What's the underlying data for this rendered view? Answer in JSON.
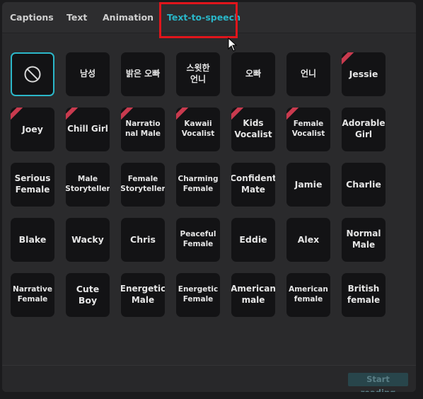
{
  "tabs": [
    {
      "label": "Captions"
    },
    {
      "label": "Text"
    },
    {
      "label": "Animation"
    },
    {
      "label": "Text-to-speech"
    }
  ],
  "voices": [
    {
      "label": "",
      "icon": "no-voice-icon",
      "selected": true
    },
    {
      "label": "남성"
    },
    {
      "label": "밝은 오빠"
    },
    {
      "label": "스윗한 언니"
    },
    {
      "label": "오빠"
    },
    {
      "label": "언니"
    },
    {
      "label": "Jessie",
      "badge": true
    },
    {
      "label": "Joey",
      "badge": true
    },
    {
      "label": "Chill Girl",
      "badge": true
    },
    {
      "label": "Narratio nal Male",
      "badge": true
    },
    {
      "label": "Kawaii Vocalist",
      "badge": true
    },
    {
      "label": "Kids Vocalist",
      "badge": true
    },
    {
      "label": "Female Vocalist",
      "badge": true
    },
    {
      "label": "Adorable Girl"
    },
    {
      "label": "Serious Female"
    },
    {
      "label": "Male Storyteller"
    },
    {
      "label": "Female Storyteller"
    },
    {
      "label": "Charming Female"
    },
    {
      "label": "Confident Mate"
    },
    {
      "label": "Jamie"
    },
    {
      "label": "Charlie"
    },
    {
      "label": "Blake"
    },
    {
      "label": "Wacky"
    },
    {
      "label": "Chris"
    },
    {
      "label": "Peaceful Female"
    },
    {
      "label": "Eddie"
    },
    {
      "label": "Alex"
    },
    {
      "label": "Normal Male"
    },
    {
      "label": "Narrative Female"
    },
    {
      "label": "Cute Boy"
    },
    {
      "label": "Energetic Male"
    },
    {
      "label": "Energetic Female"
    },
    {
      "label": "American male"
    },
    {
      "label": "American female"
    },
    {
      "label": "British female"
    }
  ],
  "footer": {
    "start_label": "Start reading"
  },
  "colors": {
    "accent": "#29b6c8",
    "highlight": "#e0151b",
    "badge": "#c93a4e"
  }
}
